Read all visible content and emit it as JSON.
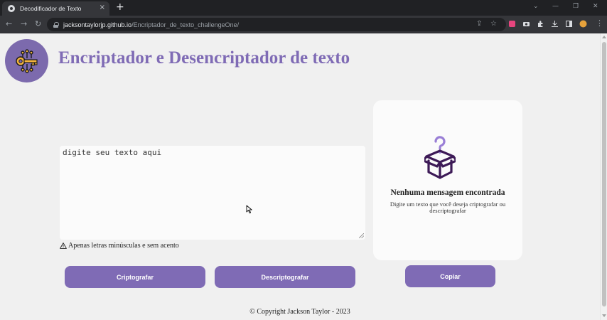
{
  "browser": {
    "tab_title": "Decodificador de Texto",
    "tab_close": "×",
    "new_tab": "+",
    "url_host": "jacksontaylorjp.github.io",
    "url_path": "/Encriptador_de_texto_challengeOne/",
    "nav": {
      "back": "←",
      "forward": "→",
      "reload": "↻"
    },
    "window": {
      "chevron": "⌄",
      "minimize": "—",
      "maximize": "❐",
      "close": "✕"
    },
    "omni": {
      "share": "⇪",
      "star": "☆"
    },
    "extension_colors": [
      "#e8457e",
      "#dadce0",
      "#dadce0",
      "#dadce0",
      "#dadce0",
      "#e7a23b"
    ]
  },
  "app": {
    "title": "Encriptador e Desencriptador de texto",
    "logo_icon": "key-circuit-icon",
    "accent_color": "#7f6bb5",
    "input": {
      "value": "digite seu texto aqui"
    },
    "hint": "Apenas letras minúsculas e sem acento",
    "buttons": {
      "encrypt": "Criptografar",
      "decrypt": "Descriptografar",
      "copy": "Copiar"
    },
    "output": {
      "icon": "question-box-icon",
      "title": "Nenhuma mensagem encontrada",
      "description": "Digite um texto que você deseja criptografar ou descriptografar"
    },
    "footer": "© Copyright Jackson Taylor - 2023"
  }
}
